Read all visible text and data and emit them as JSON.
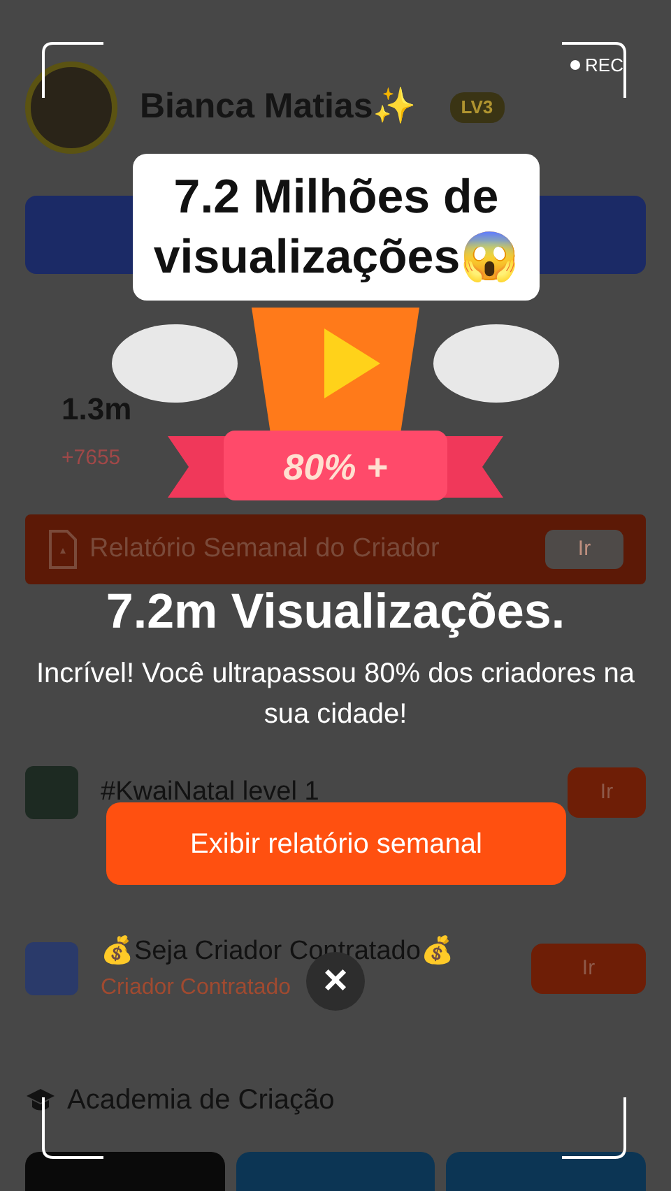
{
  "recording": {
    "label": "REC"
  },
  "profile": {
    "name": "Bianca Matias✨",
    "level_badge": "LV3"
  },
  "stats": [
    {
      "value": "1.3m",
      "change": "+7655"
    }
  ],
  "weekly_report_bar": {
    "label": "Relatório Semanal do Criador",
    "button": "Ir"
  },
  "tasks": [
    {
      "title": "#KwaiNatal level 1",
      "button": "Ir"
    },
    {
      "title": "💰Seja Criador Contratado💰",
      "subtitle": "Criador Contratado",
      "button": "Ir"
    }
  ],
  "academy": {
    "title": "Academia de Criação"
  },
  "popup": {
    "headline": "7.2 Milhões de visualizações😱",
    "ribbon": "80% +",
    "title": "7.2m Visualizações.",
    "message": "Incrível! Você ultrapassou 80% dos criadores na sua cidade!",
    "action_button": "Exibir relatório semanal",
    "close": "×"
  }
}
